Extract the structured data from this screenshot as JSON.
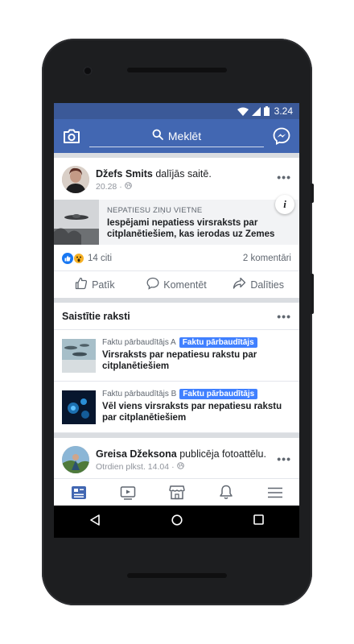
{
  "status_bar": {
    "time": "3.24"
  },
  "app_bar": {
    "search_placeholder": "Meklēt"
  },
  "post": {
    "author": "Džefs Smits",
    "action_text": "dalījās saitē.",
    "time": "20.28",
    "link": {
      "source": "NEPATIESU ZIŅU VIETNE",
      "headline": "Iespējami nepatiess virsraksts par citplanētiešiem, kas ierodas uz Zemes"
    },
    "reactions_count": "14 citi",
    "comments_count": "2 komentāri",
    "actions": {
      "like": "Patīk",
      "comment": "Komentēt",
      "share": "Dalīties"
    }
  },
  "related": {
    "title": "Saistītie raksti",
    "items": [
      {
        "source": "Faktu pārbaudītājs A",
        "badge": "Faktu pārbaudītājs",
        "headline": "Virsraksts par nepatiesu rakstu par citplanētiešiem"
      },
      {
        "source": "Faktu pārbaudītājs B",
        "badge": "Faktu pārbaudītājs",
        "headline": "Vēl viens virsraksts par nepatiesu rakstu par citplanētiešiem"
      }
    ]
  },
  "post2": {
    "author": "Greisa Džeksona",
    "action_text": "publicēja fotoattēlu.",
    "time": "Otrdien plkst. 14.04"
  },
  "colors": {
    "brand": "#4267b2",
    "status_bar": "#3b5998",
    "badge": "#4080ff"
  },
  "bottom_nav_icons": [
    "news-feed-icon",
    "video-icon",
    "marketplace-icon",
    "notifications-icon",
    "menu-icon"
  ],
  "system_nav_icons": [
    "back-icon",
    "home-icon",
    "recents-icon"
  ]
}
